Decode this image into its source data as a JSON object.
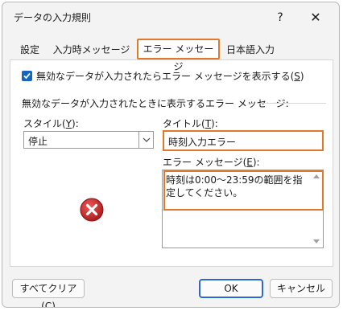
{
  "window": {
    "title": "データの入力規則",
    "help_label": "?",
    "close_label": "✕"
  },
  "tabs": [
    {
      "label": "設定"
    },
    {
      "label": "入力時メッセージ"
    },
    {
      "label": "エラー メッセージ",
      "active": true
    },
    {
      "label": "日本語入力"
    }
  ],
  "show_error": {
    "checked": true,
    "label_prefix": "無効なデータが入力されたらエラー メッセージを表示する(",
    "label_key": "S",
    "label_suffix": ")"
  },
  "section": {
    "label": "無効なデータが入力されたときに表示するエラー メッセージ:"
  },
  "style": {
    "label_prefix": "スタイル(",
    "label_key": "Y",
    "label_suffix": "):",
    "value": "停止",
    "icon": "error-stop-icon"
  },
  "title_field": {
    "label_prefix": "タイトル(",
    "label_key": "T",
    "label_suffix": "):",
    "value": "時刻入力エラー"
  },
  "message_field": {
    "label_prefix": "エラー メッセージ(",
    "label_key": "E",
    "label_suffix": "):",
    "value": "時刻は0:00～23:59の範囲を指定してください。"
  },
  "buttons": {
    "clear_prefix": "すべてクリア(",
    "clear_key": "C",
    "clear_suffix": ")",
    "ok": "OK",
    "cancel": "キャンセル"
  },
  "colors": {
    "highlight": "#e07a2a",
    "accent": "#1565c0",
    "error_red": "#c62828"
  }
}
